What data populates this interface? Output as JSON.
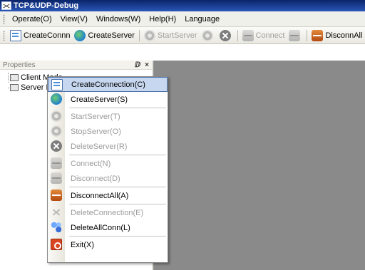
{
  "window": {
    "title": "TCP&UDP-Debug"
  },
  "menubar": {
    "items": [
      {
        "label": "Operate(O)"
      },
      {
        "label": "View(V)"
      },
      {
        "label": "Windows(W)"
      },
      {
        "label": "Help(H)"
      },
      {
        "label": "Language"
      }
    ]
  },
  "toolbar": {
    "create_conn": "CreateConnn",
    "create_server": "CreateServer",
    "start_server": "StartServer",
    "connect": "Connect",
    "disconn_all": "DisconnAll"
  },
  "properties_panel": {
    "title": "Properties",
    "pin_glyph": "ⅅ",
    "close_glyph": "×",
    "tree": [
      {
        "label": "Client Mode"
      },
      {
        "label": "Server Mode"
      }
    ]
  },
  "context_menu": {
    "items": [
      {
        "label": "CreateConnection(C)",
        "icon": "create-connection-icon",
        "enabled": true,
        "highlighted": true
      },
      {
        "label": "CreateServer(S)",
        "icon": "create-server-icon",
        "enabled": true
      },
      {
        "label": "StartServer(T)",
        "icon": "start-server-icon",
        "enabled": false
      },
      {
        "label": "StopServer(O)",
        "icon": "stop-server-icon",
        "enabled": false
      },
      {
        "label": "DeleteServer(R)",
        "icon": "delete-server-icon",
        "enabled": false
      },
      {
        "label": "Connect(N)",
        "icon": "connect-icon",
        "enabled": false
      },
      {
        "label": "Disconnect(D)",
        "icon": "disconnect-icon",
        "enabled": false
      },
      {
        "label": "DisconnectAll(A)",
        "icon": "disconnect-all-icon",
        "enabled": true
      },
      {
        "label": "DeleteConnection(E)",
        "icon": "delete-connection-icon",
        "enabled": false
      },
      {
        "label": "DeleteAllConn(L)",
        "icon": "delete-all-conn-icon",
        "enabled": true
      },
      {
        "label": "Exit(X)",
        "icon": "exit-icon",
        "enabled": true
      }
    ]
  },
  "colors": {
    "title_bar": "#0a246a",
    "main_area": "#8a8a8a",
    "menu_highlight": "#c7d7ef",
    "disabled_text": "#9b9b9b"
  }
}
